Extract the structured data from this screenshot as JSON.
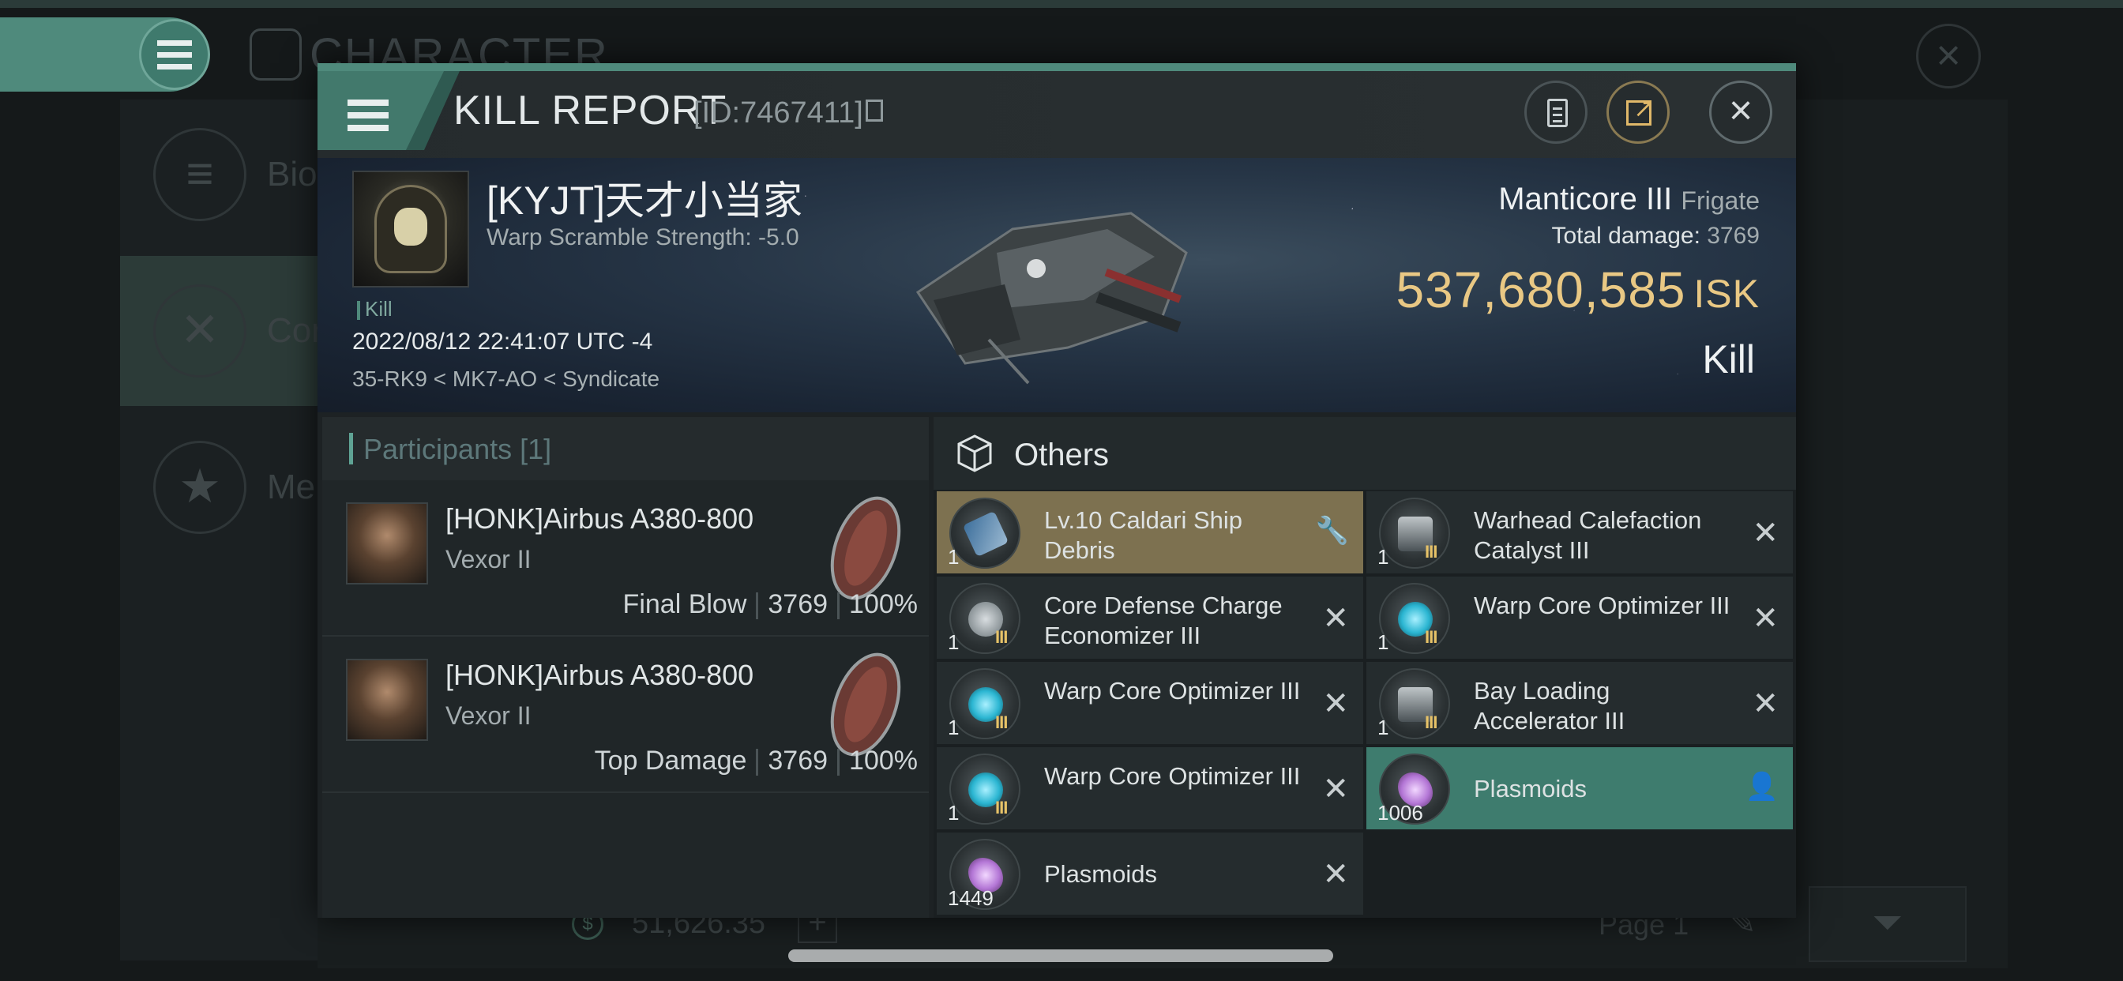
{
  "background": {
    "title": "CHARACTER",
    "sidebar": [
      {
        "label": "Bio"
      },
      {
        "label": "Cor"
      },
      {
        "label": "Me"
      }
    ],
    "wallet": "51,626.35",
    "page": "Page 1"
  },
  "dialog": {
    "title": "KILL REPORT",
    "id": "[ID:7467411]"
  },
  "victim": {
    "name": "[KYJT]天才小当家",
    "scramble": "Warp Scramble Strength: -5.0",
    "tag": "Kill",
    "datetime": "2022/08/12 22:41:07 UTC -4",
    "location": "35-RK9 < MK7-AO < Syndicate",
    "ship": "Manticore III",
    "ship_class": "Frigate",
    "total_damage_label": "Total damage:",
    "total_damage": "3769",
    "isk_value": "537,680,585",
    "isk_unit": "ISK",
    "result": "Kill"
  },
  "participants": {
    "title": "Participants [1]",
    "rows": [
      {
        "name": "[HONK]Airbus A380-800",
        "ship": "Vexor II",
        "role": "Final Blow",
        "damage": "3769",
        "percent": "100%"
      },
      {
        "name": "[HONK]Airbus A380-800",
        "ship": "Vexor II",
        "role": "Top Damage",
        "damage": "3769",
        "percent": "100%"
      }
    ]
  },
  "items": {
    "title": "Others",
    "list": [
      {
        "qty": "1",
        "name": "Lv.10 Caldari Ship Debris",
        "icon": "ship-debris-icon",
        "status": "dropped",
        "tier": ""
      },
      {
        "qty": "1",
        "name": "Warhead Calefaction Catalyst III",
        "icon": "warhead-catalyst-icon",
        "status": "destroyed",
        "tier": "III"
      },
      {
        "qty": "1",
        "name": "Core Defense Charge Economizer III",
        "icon": "shield-rig-icon",
        "status": "destroyed",
        "tier": "III"
      },
      {
        "qty": "1",
        "name": "Warp Core Optimizer III",
        "icon": "warp-core-icon",
        "status": "destroyed",
        "tier": "III"
      },
      {
        "qty": "1",
        "name": "Warp Core Optimizer III",
        "icon": "warp-core-icon",
        "status": "destroyed",
        "tier": "III"
      },
      {
        "qty": "1",
        "name": "Bay Loading Accelerator III",
        "icon": "bay-loading-icon",
        "status": "destroyed",
        "tier": "III"
      },
      {
        "qty": "1",
        "name": "Warp Core Optimizer III",
        "icon": "warp-core-icon",
        "status": "destroyed",
        "tier": "III"
      },
      {
        "qty": "1006",
        "name": "Plasmoids",
        "icon": "plasmoid-icon",
        "status": "looted",
        "tier": ""
      },
      {
        "qty": "1449",
        "name": "Plasmoids",
        "icon": "plasmoid-icon",
        "status": "destroyed",
        "tier": ""
      }
    ]
  },
  "colors": {
    "accent": "#4f8a7c",
    "isk": "#e9c884",
    "dropped_highlight": "#7d7150",
    "looted_highlight": "#3e7c6e"
  }
}
